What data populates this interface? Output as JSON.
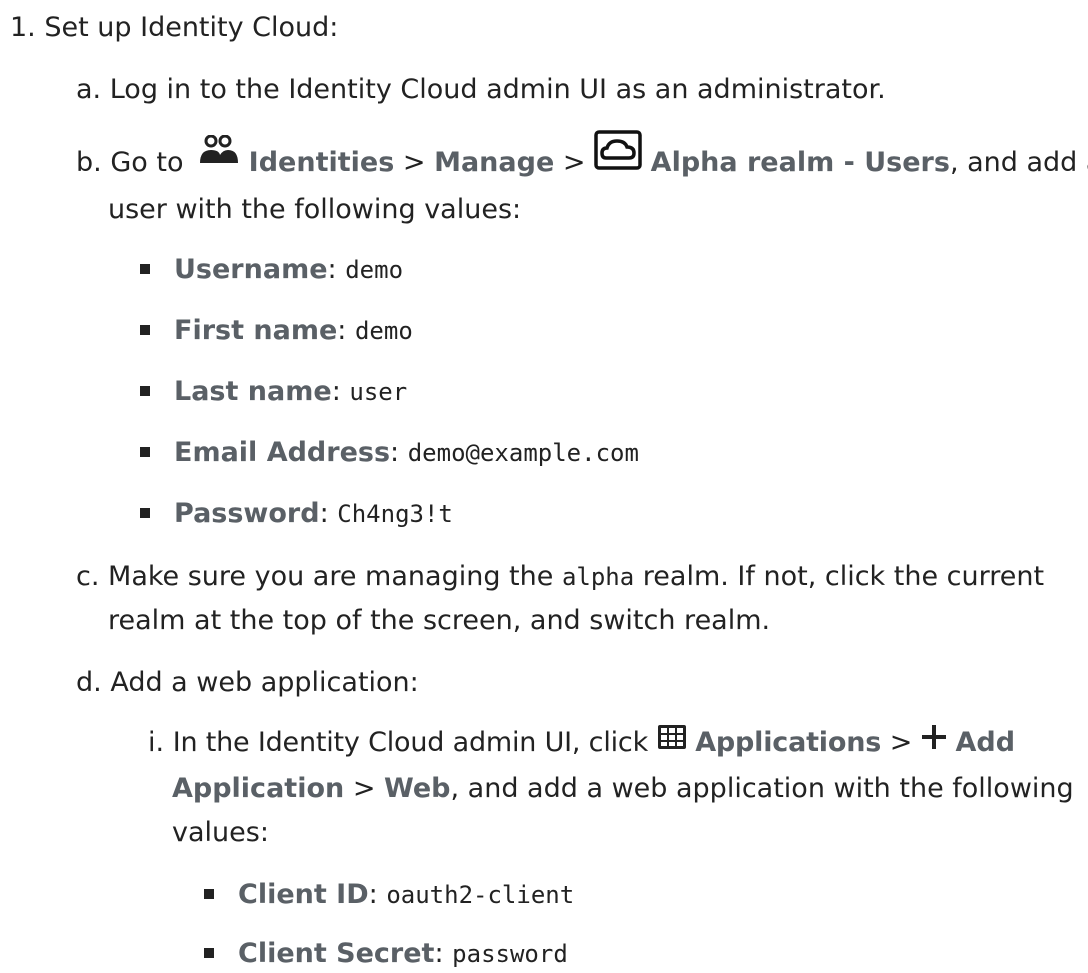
{
  "step1": {
    "marker": "1.",
    "text": "Set up Identity Cloud:"
  },
  "a": {
    "marker": "a.",
    "text": "Log in to the Identity Cloud admin UI as an administrator."
  },
  "b": {
    "marker": "b.",
    "go_to": "Go to",
    "identities": "Identities",
    "sep1": ">",
    "manage": "Manage",
    "sep2": ">",
    "realm_users": "Alpha realm - Users",
    "rest_line1": ", and add a",
    "line2": "user with the following values:",
    "fields": [
      {
        "label": "Username",
        "colon": ":",
        "value": "demo"
      },
      {
        "label": "First name",
        "colon": ":",
        "value": "demo"
      },
      {
        "label": "Last name",
        "colon": ":",
        "value": "user"
      },
      {
        "label": "Email Address",
        "colon": ":",
        "value": "demo@example.com"
      },
      {
        "label": "Password",
        "colon": ":",
        "value": "Ch4ng3!t"
      }
    ]
  },
  "c": {
    "marker": "c.",
    "pre": "Make sure you are managing the",
    "code": "alpha",
    "post": "realm. If not, click the current",
    "line2": "realm at the top of the screen, and switch realm."
  },
  "d": {
    "marker": "d.",
    "text": "Add a web application:",
    "i": {
      "marker": "i.",
      "pre": "In the Identity Cloud admin UI, click",
      "applications": "Applications",
      "sep1": ">",
      "add": "Add",
      "line2_application": "Application",
      "sep2": ">",
      "web": "Web",
      "line2_rest": ", and add a web application with the following",
      "line3": "values:",
      "fields": [
        {
          "label": "Client ID",
          "colon": ":",
          "value": "oauth2-client"
        },
        {
          "label": "Client Secret",
          "colon": ":",
          "value": "password"
        }
      ]
    }
  },
  "icons": {
    "identities": "people-icon",
    "realm": "cloud-icon",
    "applications": "apps-grid-icon",
    "add": "plus-icon"
  },
  "colors": {
    "text": "#222222",
    "ui_label": "#5a6066"
  }
}
